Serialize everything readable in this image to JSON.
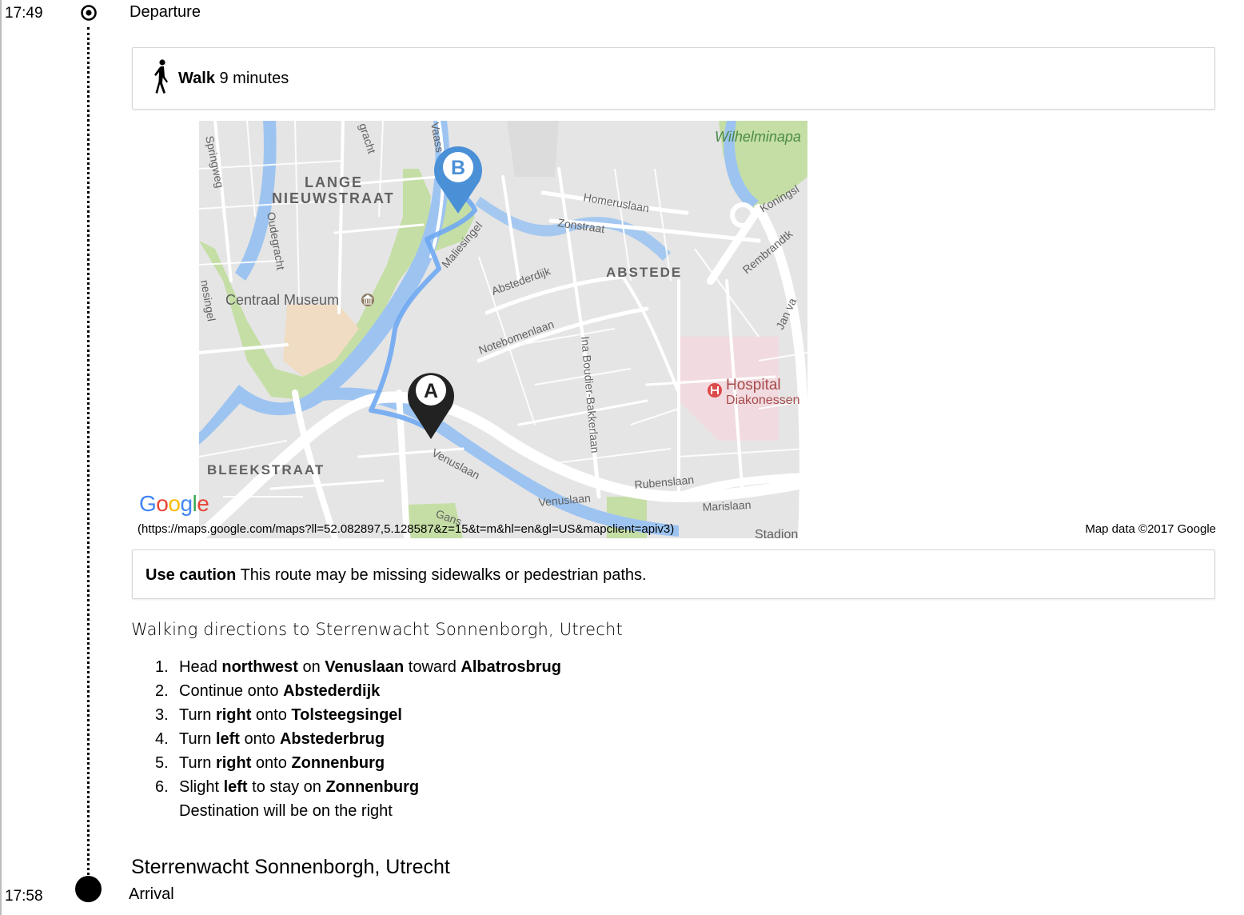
{
  "timeline": {
    "departure_time": "17:49",
    "departure_label": "Departure",
    "arrival_time": "17:58",
    "arrival_label": "Arrival"
  },
  "walk": {
    "mode_label": "Walk",
    "duration": "9 minutes"
  },
  "map": {
    "marker_a": "A",
    "marker_b": "B",
    "logo": "Google",
    "url": "(https://maps.google.com/maps?ll=52.082897,5.128587&z=15&t=m&hl=en&gl=US&mapclient=apiv3)",
    "attribution": "Map data ©2017 Google",
    "labels": {
      "lange": "LANGE",
      "nieuwstraat": "NIEUWSTRAAT",
      "centraal_museum": "Centraal Museum",
      "abstede": "ABSTEDE",
      "bleekstraat": "BLEEKSTRAAT",
      "hospital": "Hospital",
      "diakonessen": "Diakonessen",
      "wilhelmina": "Wilhelminapa",
      "homeruslaan": "Homeruslaan",
      "zonstraat": "Zonstraat",
      "abstederdijk": "Abstederdijk",
      "notebomenlaan": "Notebomenlaan",
      "maliesingel": "Maliesingel",
      "venuslaan_1": "Venuslaan",
      "venuslaan_2": "Venuslaan",
      "rubenslaan": "Rubenslaan",
      "marislaan": "Marislaan",
      "ina_boudier": "Ina Boudier-Bakkerlaan",
      "oudegracht": "Oudegracht",
      "springweg": "Springweg",
      "koningsl": "Koningsl",
      "rembrandtk": "Rembrandtk",
      "jan_van": "Jan va",
      "stadion": "Stadion",
      "tolsteegsingel": "nesingel",
      "gracht": "gracht",
      "vaassen": "Vaass",
      "gans": "Gans"
    }
  },
  "caution": {
    "title": "Use caution",
    "text": "This route may be missing sidewalks or pedestrian paths."
  },
  "directions": {
    "heading": "Walking directions to Sterrenwacht Sonnenborgh, Utrecht",
    "steps": [
      {
        "num": "1.",
        "html": "Head <b>northwest</b> on <b>Venuslaan</b> toward <b>Albatrosbrug</b>"
      },
      {
        "num": "2.",
        "html": "Continue onto <b>Abstederdijk</b>"
      },
      {
        "num": "3.",
        "html": "Turn <b>right</b> onto <b>Tolsteegsingel</b>"
      },
      {
        "num": "4.",
        "html": "Turn <b>left</b> onto <b>Abstederbrug</b>"
      },
      {
        "num": "5.",
        "html": "Turn <b>right</b> onto <b>Zonnenburg</b>"
      },
      {
        "num": "6.",
        "html": "Slight <b>left</b> to stay on <b>Zonnenburg</b>"
      }
    ],
    "destination_note": "Destination will be on the right"
  },
  "destination": {
    "title": "Sterrenwacht Sonnenborgh, Utrecht"
  },
  "colors": {
    "route": "#6fa8f2",
    "water": "#9dc4f1",
    "park": "#c5dea5",
    "map_bg": "#e5e5e5",
    "hospital": "#f1dbe0",
    "museum": "#efdcc2",
    "marker_b": "#4a90d6",
    "marker_a": "#222222"
  }
}
